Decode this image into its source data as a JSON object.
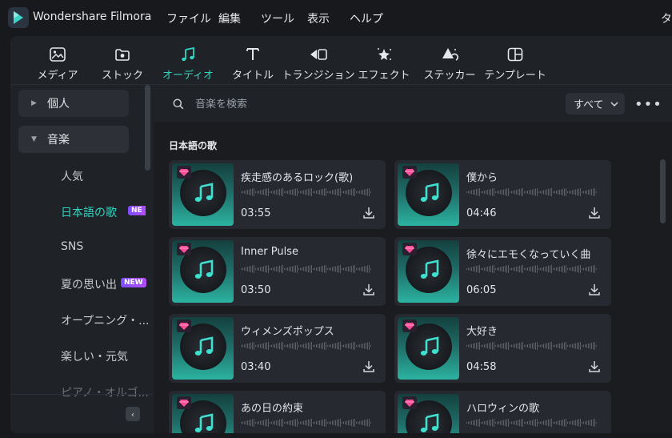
{
  "app": {
    "title": "Wondershare Filmora"
  },
  "menu": [
    "ファイル",
    "編集",
    "ツール",
    "表示",
    "ヘルプ"
  ],
  "menu_cut": "タ",
  "toolbar": [
    {
      "label": "メディア",
      "icon": "media-icon"
    },
    {
      "label": "ストック",
      "icon": "stock-icon"
    },
    {
      "label": "オーディオ",
      "icon": "music-note-icon",
      "active": true
    },
    {
      "label": "タイトル",
      "icon": "title-T-icon"
    },
    {
      "label": "トランジション",
      "icon": "transition-icon"
    },
    {
      "label": "エフェクト",
      "icon": "effect-star-icon"
    },
    {
      "label": "ステッカー",
      "icon": "sticker-icon"
    },
    {
      "label": "テンプレート",
      "icon": "template-icon"
    }
  ],
  "sidebar": {
    "groups": [
      {
        "label": "個人",
        "expanded": false
      },
      {
        "label": "音楽",
        "expanded": true
      }
    ],
    "items": [
      {
        "label": "人気"
      },
      {
        "label": "日本語の歌",
        "active": true,
        "badge": "NE"
      },
      {
        "label": "SNS"
      },
      {
        "label": "夏の思い出",
        "badge": "NEW"
      },
      {
        "label": "オープニング・..."
      },
      {
        "label": "楽しい・元気"
      },
      {
        "label": "ピアノ・オルゴ..."
      }
    ]
  },
  "search": {
    "placeholder": "音楽を検索",
    "value": ""
  },
  "filter": {
    "selected": "すべて"
  },
  "section_title": "日本語の歌",
  "tracks": [
    {
      "name": "疾走感のあるロック(歌)",
      "duration": "03:55"
    },
    {
      "name": "僕から",
      "duration": "04:46"
    },
    {
      "name": "Inner Pulse",
      "duration": "03:50"
    },
    {
      "name": "徐々にエモくなっていく曲",
      "duration": "06:05"
    },
    {
      "name": "ウィメンズポップス",
      "duration": "03:40"
    },
    {
      "name": "大好き",
      "duration": "04:58"
    },
    {
      "name": "あの日の約束",
      "duration": ""
    },
    {
      "name": "ハロウィンの歌",
      "duration": ""
    }
  ],
  "colors": {
    "accent": "#2fd6c0",
    "background": "#17191d",
    "panel": "#1f2226",
    "card": "#262a30"
  }
}
